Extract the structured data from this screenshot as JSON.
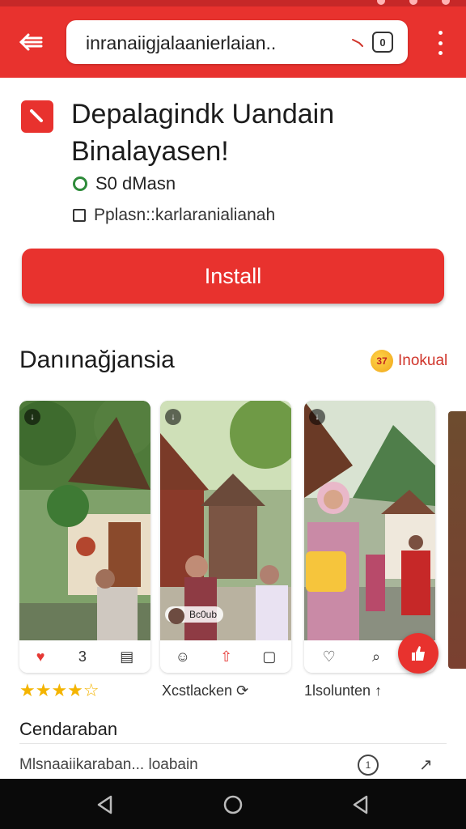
{
  "browser": {
    "url": "inranaiigjalaanierlaian..",
    "back_icon": "arrow-left-icon",
    "tab_count": "0",
    "accent": "#e8322e"
  },
  "app": {
    "title_line1": "Depalagindk Uandain",
    "title_line2": "Binalayasen!",
    "downloads": "S0 dMasn",
    "permission": "Pplasn::karlaranialianah",
    "install_label": "Install"
  },
  "section": {
    "title": "Danınağjansia",
    "link_label": "Inokual",
    "link_badge": "37"
  },
  "cards": [
    {
      "badge": "",
      "actions": [
        "♥",
        "3",
        "▤"
      ]
    },
    {
      "badge": "Bc0ub",
      "actions": [
        "☺",
        "⇧",
        "▢"
      ]
    },
    {
      "badge": "",
      "actions": [
        "♡",
        "⌕",
        ""
      ]
    }
  ],
  "meta": {
    "rating": 4.5,
    "stars": "★★★★☆",
    "label1": "Xcstlacken",
    "label2": "1lsolunten"
  },
  "footer": {
    "heading": "Cendaraban",
    "row_text": "Mlsnaaiikaraban... loabain"
  }
}
